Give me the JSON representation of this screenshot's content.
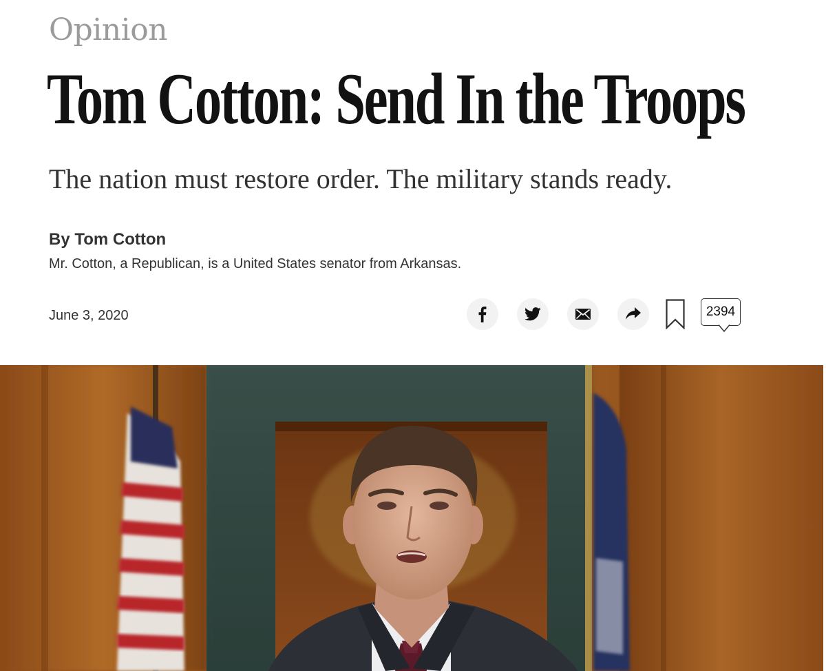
{
  "article": {
    "section": "Opinion",
    "headline": "Tom Cotton: Send In the Troops",
    "summary": "The nation must restore order. The military stands ready.",
    "byline": "By Tom Cotton",
    "author_bio": "Mr. Cotton, a Republican, is a United States senator from Arkansas.",
    "date": "June 3, 2020"
  },
  "share_bar": {
    "buttons": [
      {
        "icon": "facebook-icon"
      },
      {
        "icon": "twitter-icon"
      },
      {
        "icon": "email-icon"
      },
      {
        "icon": "share-arrow-icon"
      },
      {
        "icon": "bookmark-icon"
      }
    ],
    "comment_count": "2394"
  },
  "lead_image": {
    "icon": "photo"
  },
  "colors": {
    "text": "#121212",
    "section_label": "#9b9b9b",
    "button_bg": "#f2f2f2"
  }
}
